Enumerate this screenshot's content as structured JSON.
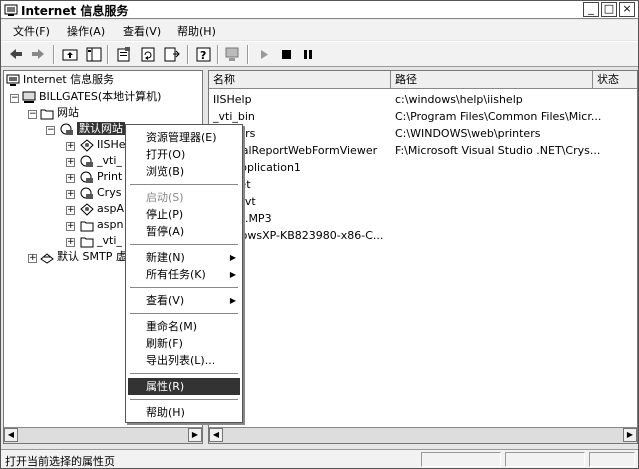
{
  "window": {
    "title": "Internet 信息服务",
    "controls": [
      "_",
      "□",
      "×"
    ]
  },
  "menu": [
    "文件(F)",
    "操作(A)",
    "查看(V)",
    "帮助(H)"
  ],
  "toolbar": {
    "icons": [
      "back-icon",
      "forward-icon",
      "up-folder-icon",
      "show-hide-tree-icon",
      "properties-icon",
      "refresh-icon",
      "export-list-icon",
      "help-icon",
      "computer-icon",
      "start-icon",
      "stop-icon",
      "pause-icon"
    ]
  },
  "tree": {
    "root": "Internet 信息服务",
    "computer": "BILLGATES(本地计算机)",
    "websites": "网站",
    "default_site": "默认网站",
    "children": [
      "IISHe",
      "_vti_",
      "Print",
      "Crys",
      "aspA",
      "aspn",
      "_vti_"
    ],
    "smtp": "默认 SMTP 虚"
  },
  "list": {
    "columns": [
      "名称",
      "路径",
      "状态"
    ],
    "rows": [
      {
        "name": "IISHelp",
        "path": "c:\\windows\\help\\iishelp"
      },
      {
        "name": "_vti_bin",
        "path": "C:\\Program Files\\Common Files\\Micr..."
      },
      {
        "name": "Printers",
        "path": "C:\\WINDOWS\\web\\printers"
      },
      {
        "name": "CrystalReportWebFormViewer",
        "path": "F:\\Microsoft Visual Studio .NET\\Crys..."
      },
      {
        "name": "aspApplication1",
        "path": ""
      },
      {
        "name": "aspnet",
        "path": ""
      },
      {
        "name": "_vti_pvt",
        "path": ""
      },
      {
        "name": "Amon.MP3",
        "path": ""
      },
      {
        "name": "WindowsXP-KB823980-x86-C...",
        "path": ""
      }
    ]
  },
  "context_menu": {
    "items": [
      {
        "label": "资源管理器(E)"
      },
      {
        "label": "打开(O)"
      },
      {
        "label": "浏览(B)"
      },
      {
        "label": "启动(S)",
        "disabled": true
      },
      {
        "label": "停止(P)"
      },
      {
        "label": "暂停(A)"
      },
      {
        "label": "新建(N)",
        "submenu": true
      },
      {
        "label": "所有任务(K)",
        "submenu": true
      },
      {
        "label": "查看(V)",
        "submenu": true
      },
      {
        "label": "重命名(M)"
      },
      {
        "label": "刷新(F)"
      },
      {
        "label": "导出列表(L)..."
      },
      {
        "label": "属性(R)",
        "highlighted": true
      },
      {
        "label": "帮助(H)"
      }
    ]
  },
  "status": {
    "text": "打开当前选择的属性页"
  }
}
